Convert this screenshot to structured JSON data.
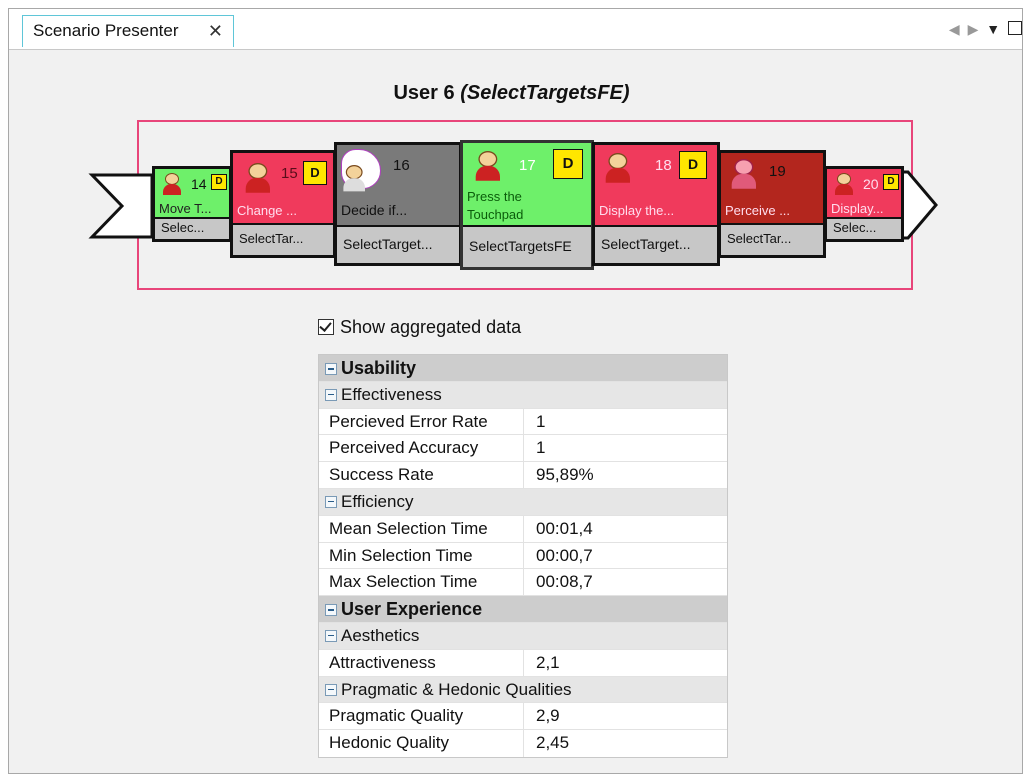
{
  "tab": {
    "title": "Scenario Presenter",
    "close": "✕"
  },
  "window_controls": {
    "back": "◀",
    "forward": "▶",
    "menu": "▼"
  },
  "header": {
    "user": "User 6",
    "scenario": "(SelectTargetsFE)"
  },
  "cards": [
    {
      "num": "14",
      "badge": "D",
      "desc": "Move T...",
      "label": "Selec..."
    },
    {
      "num": "15",
      "badge": "D",
      "desc": "Change ...",
      "label": "SelectTar..."
    },
    {
      "num": "16",
      "badge": "",
      "desc": "Decide if...",
      "label": "SelectTarget..."
    },
    {
      "num": "17",
      "badge": "D",
      "desc": "Press the",
      "desc2": "Touchpad",
      "label": "SelectTargetsFE"
    },
    {
      "num": "18",
      "badge": "D",
      "desc": "Display the...",
      "label": "SelectTarget..."
    },
    {
      "num": "19",
      "badge": "",
      "desc": "Perceive ...",
      "label": "SelectTar..."
    },
    {
      "num": "20",
      "badge": "D",
      "desc": "Display...",
      "label": "Selec..."
    }
  ],
  "aggregate": {
    "label": "Show aggregated data",
    "checked": true
  },
  "table": {
    "usability": "Usability",
    "effectiveness": "Effectiveness",
    "perceived_error_rate": {
      "k": "Percieved Error Rate",
      "v": "1"
    },
    "perceived_accuracy": {
      "k": "Perceived Accuracy",
      "v": "1"
    },
    "success_rate": {
      "k": "Success Rate",
      "v": "95,89%"
    },
    "efficiency": "Efficiency",
    "mean_selection_time": {
      "k": "Mean Selection Time",
      "v": "00:01,4"
    },
    "min_selection_time": {
      "k": "Min Selection Time",
      "v": "00:00,7"
    },
    "max_selection_time": {
      "k": "Max Selection Time",
      "v": "00:08,7"
    },
    "user_experience": "User Experience",
    "aesthetics": "Aesthetics",
    "attractiveness": {
      "k": "Attractiveness",
      "v": "2,1"
    },
    "pragmatic_hedonic": "Pragmatic & Hedonic Qualities",
    "pragmatic_quality": {
      "k": "Pragmatic Quality",
      "v": "2,9"
    },
    "hedonic_quality": {
      "k": "Hedonic Quality",
      "v": "2,45"
    }
  },
  "colors": {
    "tab_border": "#5fc6d8",
    "strip_border": "#e8457a",
    "green": "#6ef06a",
    "pink": "#f03a5c",
    "grey": "#7a7a7a",
    "dark_red": "#b3261e",
    "badge": "#ffe600"
  }
}
